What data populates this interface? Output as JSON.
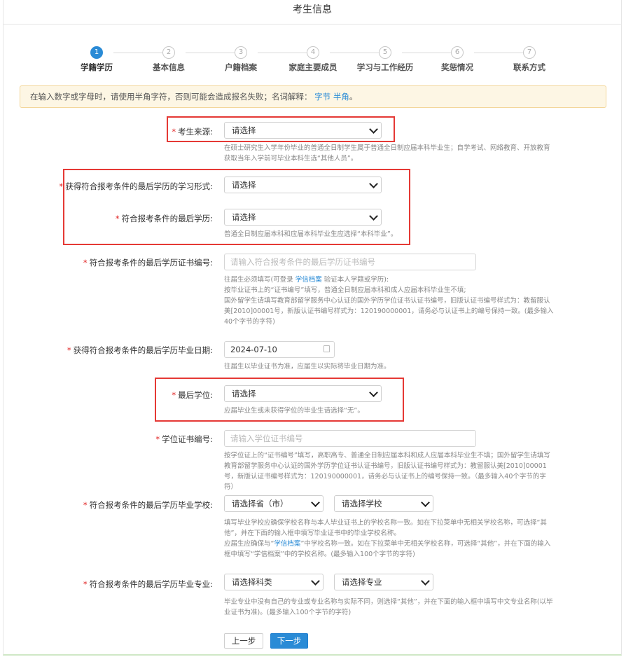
{
  "page": {
    "title": "考生信息"
  },
  "steps": [
    {
      "num": "1",
      "label": "学籍学历",
      "active": true
    },
    {
      "num": "2",
      "label": "基本信息",
      "active": false
    },
    {
      "num": "3",
      "label": "户籍档案",
      "active": false
    },
    {
      "num": "4",
      "label": "家庭主要成员",
      "active": false
    },
    {
      "num": "5",
      "label": "学习与工作经历",
      "active": false
    },
    {
      "num": "6",
      "label": "奖惩情况",
      "active": false
    },
    {
      "num": "7",
      "label": "联系方式",
      "active": false
    }
  ],
  "notice": {
    "text": "在输入数字或字母时，请使用半角字符，否则可能会造成报名失败；名词解释：",
    "link1": "字节",
    "link2": "半角",
    "end": "。"
  },
  "fields": {
    "source": {
      "label": "考生来源:",
      "value": "请选择",
      "hint": "在硕士研究生入学年份毕业的普通全日制学生属于普通全日制应届本科毕业生；自学考试、网络教育、开放教育获取当年入学前可毕业本科生选“其他人员”。"
    },
    "study_form": {
      "label": "获得符合报考条件的最后学历的学习形式:",
      "value": "请选择"
    },
    "last_degree_edu": {
      "label": "符合报考条件的最后学历:",
      "value": "请选择",
      "hint": "普通全日制应届本科和应届本科毕业生应选择“本科毕业”。"
    },
    "cert_no": {
      "label": "符合报考条件的最后学历证书编号:",
      "placeholder": "请输入符合报考条件的最后学历证书编号",
      "hint1_a": "往届生必须填写(可登录 ",
      "hint1_link": "学信档案",
      "hint1_b": " 验证本人学籍或学历):",
      "hint2": "按毕业证书上的“证书编号”填写，普通全日制应届本科和成人应届本科毕业生不填;",
      "hint3": "国外留学生请填写教育部留学服务中心认证的国外学历学位证书认证书编号，旧版认证书编号样式为：教留服认美[2010]00001号，新版认证书编号样式为：120190000001，请务必与认证书上的编号保持一致。(最多输入40个字节的字符)"
    },
    "grad_date": {
      "label": "获得符合报考条件的最后学历毕业日期:",
      "value": "2024-07-10",
      "hint": "往届生以毕业证书为准，应届生以实际将毕业日期为准。"
    },
    "last_degree": {
      "label": "最后学位:",
      "value": "请选择",
      "hint": "应届毕业生或未获得学位的毕业生请选择“无”。"
    },
    "degree_cert": {
      "label": "学位证书编号:",
      "placeholder": "请输入学位证书编号",
      "hint": "按学位证上的“证书编号”填写，高职高专、普通全日制应届本科和成人应届本科毕业生不填；国外留学生请填写教育部留学服务中心认证的国外学历学位证书认证书编号，旧版认证书编号样式为：教留服认美[2010]00001号，新版认证书编号样式为：120190000001，请务必与认证书上的编号保持一致。（最多输入40个字节的字符）"
    },
    "grad_school": {
      "label": "符合报考条件的最后学历毕业学校:",
      "province": "请选择省（市）",
      "school": "请选择学校",
      "hint1": "填写毕业学校应确保学校名称与本人毕业证书上的学校名称一致。如在下拉菜单中无相关学校名称，可选择“其他”，并在下面的输入框中填写毕业证书中的毕业学校名称。",
      "hint2_a": "应届生应确保与“",
      "hint2_link": "学信档案",
      "hint2_b": "”中学校名称一致。如在下拉菜单中无相关学校名称，可选择“其他”，并在下面的输入框中填写“学信档案”中的学校名称。(最多输入100个字节的字符)"
    },
    "grad_major": {
      "label": "符合报考条件的最后学历毕业专业:",
      "category": "请选择科类",
      "major": "请选择专业",
      "hint": "毕业专业中没有自己的专业或专业名称与实际不同，则选择“其他”，并在下面的输入框中填写中文专业名称(以毕业证书为准)。(最多输入100个字节的字符)"
    }
  },
  "required_mark": "*",
  "buttons": {
    "prev": "上一步",
    "next": "下一步"
  },
  "colors": {
    "accent": "#2a8bd6",
    "highlight": "#e53935",
    "required": "#e02020",
    "notice_bg": "#fdf6e4"
  }
}
